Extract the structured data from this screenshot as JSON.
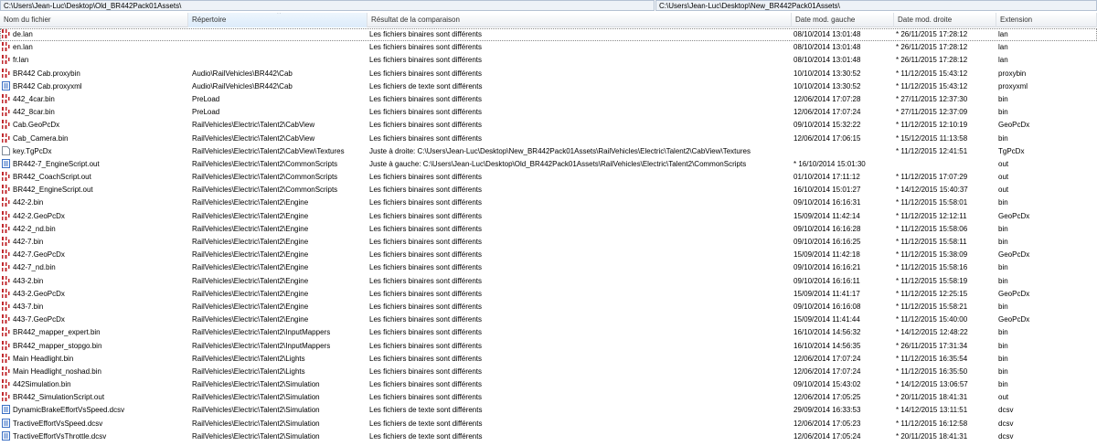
{
  "paths": {
    "left": "C:\\Users\\Jean-Luc\\Desktop\\Old_BR442Pack01Assets\\",
    "right": "C:\\Users\\Jean-Luc\\Desktop\\New_BR442Pack01Assets\\"
  },
  "columns": {
    "name": "Nom du fichier",
    "dir": "Répertoire",
    "result": "Résultat de la comparaison",
    "date_left": "Date mod. gauche",
    "date_right": "Date mod. droite",
    "ext": "Extension"
  },
  "colors": {
    "binary_icon": "#c0282d",
    "text_icon": "#3a6fc4",
    "path_bg": "#eef2f7"
  },
  "rows": [
    {
      "icon": "binary-file-icon",
      "name": "de.lan",
      "dir": "",
      "result": "Les fichiers binaires sont différents",
      "dl": "08/10/2014 13:01:48",
      "dr": "* 26/11/2015 17:28:12",
      "ext": "lan"
    },
    {
      "icon": "binary-file-icon",
      "name": "en.lan",
      "dir": "",
      "result": "Les fichiers binaires sont différents",
      "dl": "08/10/2014 13:01:48",
      "dr": "* 26/11/2015 17:28:12",
      "ext": "lan"
    },
    {
      "icon": "binary-file-icon",
      "name": "fr.lan",
      "dir": "",
      "result": "Les fichiers binaires sont différents",
      "dl": "08/10/2014 13:01:48",
      "dr": "* 26/11/2015 17:28:12",
      "ext": "lan"
    },
    {
      "icon": "binary-file-icon",
      "name": "BR442 Cab.proxybin",
      "dir": "Audio\\RailVehicles\\BR442\\Cab",
      "result": "Les fichiers binaires sont différents",
      "dl": "10/10/2014 13:30:52",
      "dr": "* 11/12/2015 15:43:12",
      "ext": "proxybin"
    },
    {
      "icon": "text-file-icon",
      "name": "BR442 Cab.proxyxml",
      "dir": "Audio\\RailVehicles\\BR442\\Cab",
      "result": "Les fichiers de texte sont différents",
      "dl": "10/10/2014 13:30:52",
      "dr": "* 11/12/2015 15:43:12",
      "ext": "proxyxml"
    },
    {
      "icon": "binary-file-icon",
      "name": "442_4car.bin",
      "dir": "PreLoad",
      "result": "Les fichiers binaires sont différents",
      "dl": "12/06/2014 17:07:28",
      "dr": "* 27/11/2015 12:37:30",
      "ext": "bin"
    },
    {
      "icon": "binary-file-icon",
      "name": "442_8car.bin",
      "dir": "PreLoad",
      "result": "Les fichiers binaires sont différents",
      "dl": "12/06/2014 17:07:24",
      "dr": "* 27/11/2015 12:37:09",
      "ext": "bin"
    },
    {
      "icon": "binary-file-icon",
      "name": "Cab.GeoPcDx",
      "dir": "RailVehicles\\Electric\\Talent2\\CabView",
      "result": "Les fichiers binaires sont différents",
      "dl": "09/10/2014 15:32:22",
      "dr": "* 11/12/2015 12:10:19",
      "ext": "GeoPcDx"
    },
    {
      "icon": "binary-file-icon",
      "name": "Cab_Camera.bin",
      "dir": "RailVehicles\\Electric\\Talent2\\CabView",
      "result": "Les fichiers binaires sont différents",
      "dl": "12/06/2014 17:06:15",
      "dr": "* 15/12/2015 11:13:58",
      "ext": "bin"
    },
    {
      "icon": "plain-file-icon",
      "name": "key.TgPcDx",
      "dir": "RailVehicles\\Electric\\Talent2\\CabView\\Textures",
      "result": "Juste à droite: C:\\Users\\Jean-Luc\\Desktop\\New_BR442Pack01Assets\\RailVehicles\\Electric\\Talent2\\CabView\\Textures",
      "dl": "",
      "dr": "* 11/12/2015 12:41:51",
      "ext": "TgPcDx"
    },
    {
      "icon": "text-file-icon",
      "name": "BR442-7_EngineScript.out",
      "dir": "RailVehicles\\Electric\\Talent2\\CommonScripts",
      "result": "Juste à gauche: C:\\Users\\Jean-Luc\\Desktop\\Old_BR442Pack01Assets\\RailVehicles\\Electric\\Talent2\\CommonScripts",
      "dl": "* 16/10/2014 15:01:30",
      "dr": "",
      "ext": "out"
    },
    {
      "icon": "binary-file-icon",
      "name": "BR442_CoachScript.out",
      "dir": "RailVehicles\\Electric\\Talent2\\CommonScripts",
      "result": "Les fichiers binaires sont différents",
      "dl": "01/10/2014 17:11:12",
      "dr": "* 11/12/2015 17:07:29",
      "ext": "out"
    },
    {
      "icon": "binary-file-icon",
      "name": "BR442_EngineScript.out",
      "dir": "RailVehicles\\Electric\\Talent2\\CommonScripts",
      "result": "Les fichiers binaires sont différents",
      "dl": "16/10/2014 15:01:27",
      "dr": "* 14/12/2015 15:40:37",
      "ext": "out"
    },
    {
      "icon": "binary-file-icon",
      "name": "442-2.bin",
      "dir": "RailVehicles\\Electric\\Talent2\\Engine",
      "result": "Les fichiers binaires sont différents",
      "dl": "09/10/2014 16:16:31",
      "dr": "* 11/12/2015 15:58:01",
      "ext": "bin"
    },
    {
      "icon": "binary-file-icon",
      "name": "442-2.GeoPcDx",
      "dir": "RailVehicles\\Electric\\Talent2\\Engine",
      "result": "Les fichiers binaires sont différents",
      "dl": "15/09/2014 11:42:14",
      "dr": "* 11/12/2015 12:12:11",
      "ext": "GeoPcDx"
    },
    {
      "icon": "binary-file-icon",
      "name": "442-2_nd.bin",
      "dir": "RailVehicles\\Electric\\Talent2\\Engine",
      "result": "Les fichiers binaires sont différents",
      "dl": "09/10/2014 16:16:28",
      "dr": "* 11/12/2015 15:58:06",
      "ext": "bin"
    },
    {
      "icon": "binary-file-icon",
      "name": "442-7.bin",
      "dir": "RailVehicles\\Electric\\Talent2\\Engine",
      "result": "Les fichiers binaires sont différents",
      "dl": "09/10/2014 16:16:25",
      "dr": "* 11/12/2015 15:58:11",
      "ext": "bin"
    },
    {
      "icon": "binary-file-icon",
      "name": "442-7.GeoPcDx",
      "dir": "RailVehicles\\Electric\\Talent2\\Engine",
      "result": "Les fichiers binaires sont différents",
      "dl": "15/09/2014 11:42:18",
      "dr": "* 11/12/2015 15:38:09",
      "ext": "GeoPcDx"
    },
    {
      "icon": "binary-file-icon",
      "name": "442-7_nd.bin",
      "dir": "RailVehicles\\Electric\\Talent2\\Engine",
      "result": "Les fichiers binaires sont différents",
      "dl": "09/10/2014 16:16:21",
      "dr": "* 11/12/2015 15:58:16",
      "ext": "bin"
    },
    {
      "icon": "binary-file-icon",
      "name": "443-2.bin",
      "dir": "RailVehicles\\Electric\\Talent2\\Engine",
      "result": "Les fichiers binaires sont différents",
      "dl": "09/10/2014 16:16:11",
      "dr": "* 11/12/2015 15:58:19",
      "ext": "bin"
    },
    {
      "icon": "binary-file-icon",
      "name": "443-2.GeoPcDx",
      "dir": "RailVehicles\\Electric\\Talent2\\Engine",
      "result": "Les fichiers binaires sont différents",
      "dl": "15/09/2014 11:41:17",
      "dr": "* 11/12/2015 12:25:15",
      "ext": "GeoPcDx"
    },
    {
      "icon": "binary-file-icon",
      "name": "443-7.bin",
      "dir": "RailVehicles\\Electric\\Talent2\\Engine",
      "result": "Les fichiers binaires sont différents",
      "dl": "09/10/2014 16:16:08",
      "dr": "* 11/12/2015 15:58:21",
      "ext": "bin"
    },
    {
      "icon": "binary-file-icon",
      "name": "443-7.GeoPcDx",
      "dir": "RailVehicles\\Electric\\Talent2\\Engine",
      "result": "Les fichiers binaires sont différents",
      "dl": "15/09/2014 11:41:44",
      "dr": "* 11/12/2015 15:40:00",
      "ext": "GeoPcDx"
    },
    {
      "icon": "binary-file-icon",
      "name": "BR442_mapper_expert.bin",
      "dir": "RailVehicles\\Electric\\Talent2\\InputMappers",
      "result": "Les fichiers binaires sont différents",
      "dl": "16/10/2014 14:56:32",
      "dr": "* 14/12/2015 12:48:22",
      "ext": "bin"
    },
    {
      "icon": "binary-file-icon",
      "name": "BR442_mapper_stopgo.bin",
      "dir": "RailVehicles\\Electric\\Talent2\\InputMappers",
      "result": "Les fichiers binaires sont différents",
      "dl": "16/10/2014 14:56:35",
      "dr": "* 26/11/2015 17:31:34",
      "ext": "bin"
    },
    {
      "icon": "binary-file-icon",
      "name": "Main Headlight.bin",
      "dir": "RailVehicles\\Electric\\Talent2\\Lights",
      "result": "Les fichiers binaires sont différents",
      "dl": "12/06/2014 17:07:24",
      "dr": "* 11/12/2015 16:35:54",
      "ext": "bin"
    },
    {
      "icon": "binary-file-icon",
      "name": "Main Headlight_noshad.bin",
      "dir": "RailVehicles\\Electric\\Talent2\\Lights",
      "result": "Les fichiers binaires sont différents",
      "dl": "12/06/2014 17:07:24",
      "dr": "* 11/12/2015 16:35:50",
      "ext": "bin"
    },
    {
      "icon": "binary-file-icon",
      "name": "442Simulation.bin",
      "dir": "RailVehicles\\Electric\\Talent2\\Simulation",
      "result": "Les fichiers binaires sont différents",
      "dl": "09/10/2014 15:43:02",
      "dr": "* 14/12/2015 13:06:57",
      "ext": "bin"
    },
    {
      "icon": "binary-file-icon",
      "name": "BR442_SimulationScript.out",
      "dir": "RailVehicles\\Electric\\Talent2\\Simulation",
      "result": "Les fichiers binaires sont différents",
      "dl": "12/06/2014 17:05:25",
      "dr": "* 20/11/2015 18:41:31",
      "ext": "out"
    },
    {
      "icon": "text-file-icon",
      "name": "DynamicBrakeEffortVsSpeed.dcsv",
      "dir": "RailVehicles\\Electric\\Talent2\\Simulation",
      "result": "Les fichiers de texte sont différents",
      "dl": "29/09/2014 16:33:53",
      "dr": "* 14/12/2015 13:11:51",
      "ext": "dcsv"
    },
    {
      "icon": "text-file-icon",
      "name": "TractiveEffortVsSpeed.dcsv",
      "dir": "RailVehicles\\Electric\\Talent2\\Simulation",
      "result": "Les fichiers de texte sont différents",
      "dl": "12/06/2014 17:05:23",
      "dr": "* 11/12/2015 16:12:58",
      "ext": "dcsv"
    },
    {
      "icon": "text-file-icon",
      "name": "TractiveEffortVsThrottle.dcsv",
      "dir": "RailVehicles\\Electric\\Talent2\\Simulation",
      "result": "Les fichiers de texte sont différents",
      "dl": "12/06/2014 17:05:24",
      "dr": "* 20/11/2015 18:41:31",
      "ext": "dcsv"
    }
  ]
}
